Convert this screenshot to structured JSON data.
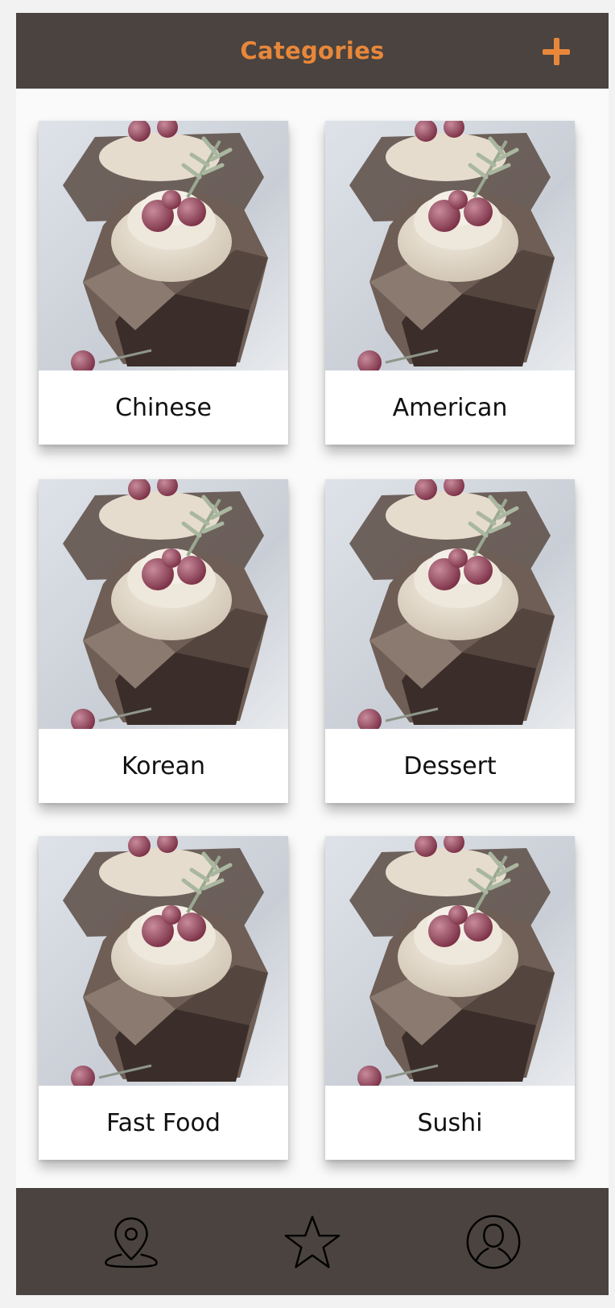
{
  "header": {
    "title": "Categories",
    "add_icon": "plus-icon"
  },
  "categories": [
    {
      "label": "Chinese"
    },
    {
      "label": "American"
    },
    {
      "label": "Korean"
    },
    {
      "label": "Dessert"
    },
    {
      "label": "Fast Food"
    },
    {
      "label": "Sushi"
    }
  ],
  "tabbar": {
    "items": [
      {
        "icon": "map-pin-icon"
      },
      {
        "icon": "star-icon"
      },
      {
        "icon": "profile-icon"
      }
    ]
  },
  "colors": {
    "bar": "#4a433f",
    "accent": "#e8873a",
    "card": "#ffffff"
  }
}
